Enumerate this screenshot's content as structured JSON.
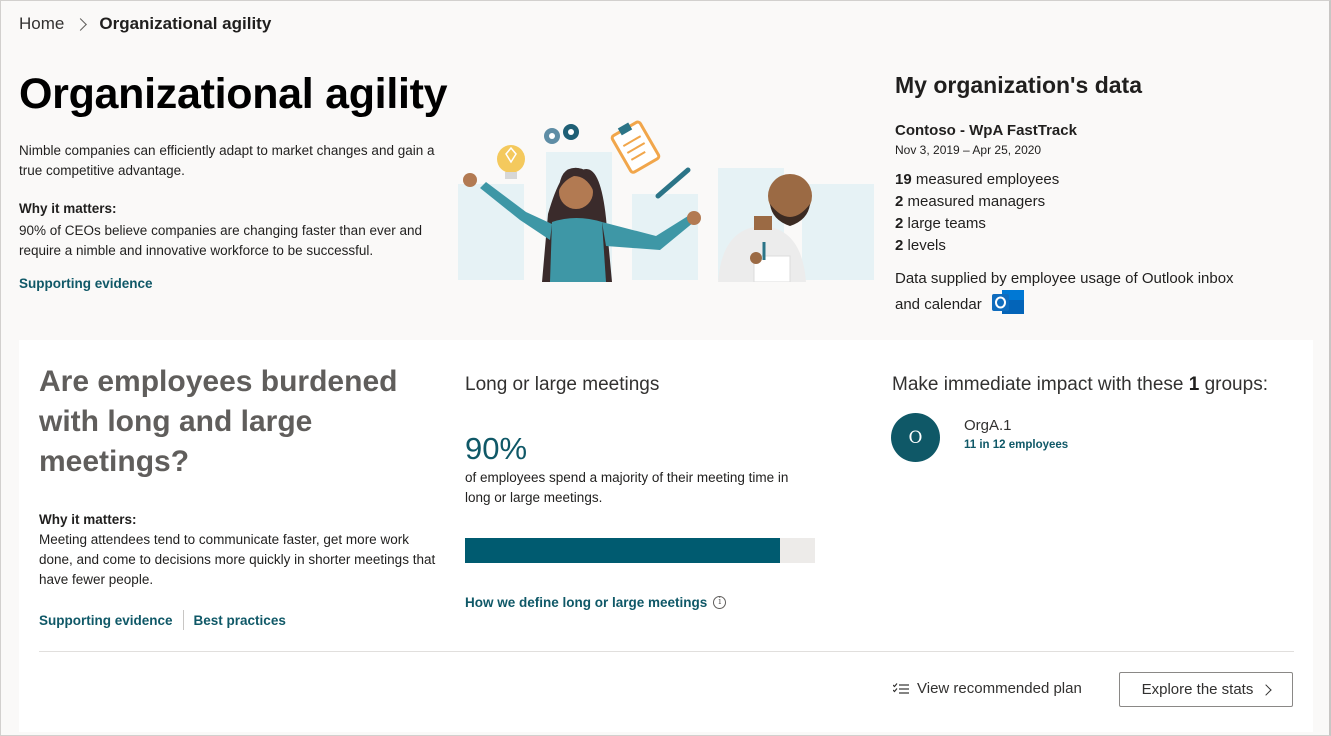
{
  "breadcrumb": {
    "home": "Home",
    "current": "Organizational agility"
  },
  "hero": {
    "title": "Organizational agility",
    "description": "Nimble companies can efficiently adapt to market changes and gain a true competitive advantage.",
    "why_heading": "Why it matters:",
    "why_text": "90% of CEOs believe companies are changing faster than ever and require a nimble and innovative workforce to be successful.",
    "link": "Supporting evidence"
  },
  "org": {
    "title": "My organization's data",
    "name": "Contoso - WpA FastTrack",
    "range": "Nov 3, 2019 – Apr 25, 2020",
    "stats": [
      {
        "num": "19",
        "label": "measured employees"
      },
      {
        "num": "2",
        "label": "measured managers"
      },
      {
        "num": "2",
        "label": "large teams"
      },
      {
        "num": "2",
        "label": "levels"
      }
    ],
    "source": "Data supplied by employee usage of Outlook inbox and calendar"
  },
  "card": {
    "question": "Are employees burdened with long and large meetings?",
    "why_heading": "Why it matters:",
    "why_text": "Meeting attendees tend to communicate faster, get more work done, and come to decisions more quickly in shorter meetings that have fewer people.",
    "link_evidence": "Supporting evidence",
    "link_practices": "Best practices",
    "metric_title": "Long or large meetings",
    "metric_value": "90%",
    "metric_fraction": 0.9,
    "metric_desc": "of employees spend a majority of their meeting time in long or large meetings.",
    "metric_link": "How we define long or large meetings",
    "groups_prefix": "Make immediate impact with these",
    "groups_count": "1",
    "groups_suffix": "groups:",
    "group": {
      "avatar": "O",
      "name": "OrgA.1",
      "count": "11 in 12 employees"
    },
    "plan_label": "View recommended plan",
    "explore_label": "Explore the stats"
  },
  "colors": {
    "accent": "#0f5867",
    "bar_fill": "#005b70",
    "bar_track": "#edebe9"
  }
}
